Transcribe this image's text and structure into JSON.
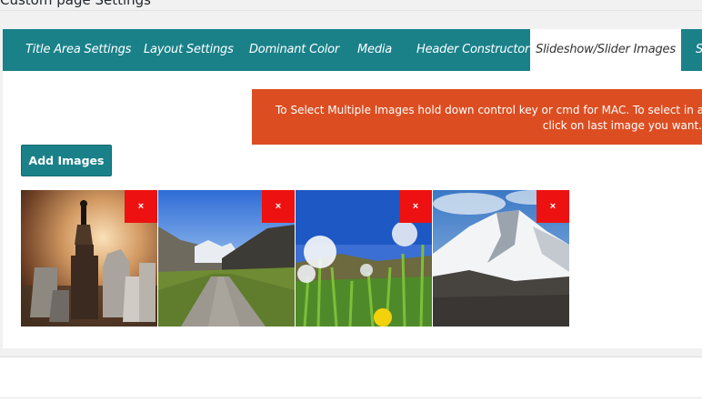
{
  "page": {
    "title": "Custom page Settings"
  },
  "tabs": [
    {
      "label": "Title Area Settings",
      "active": false
    },
    {
      "label": "Layout Settings",
      "active": false
    },
    {
      "label": "Dominant Color",
      "active": false
    },
    {
      "label": "Media",
      "active": false
    },
    {
      "label": "Header Constructor",
      "active": false
    },
    {
      "label": "Slideshow/Slider Images",
      "active": true
    },
    {
      "label": "S",
      "active": false
    }
  ],
  "notice": {
    "line1": "To Select Multiple Images hold down control key or cmd for MAC. To select in a row i",
    "line2": "click on last image you want."
  },
  "add_button": {
    "label": "Add Images"
  },
  "gallery": {
    "remove_label": "×",
    "images": [
      {
        "name": "chess-pieces-image"
      },
      {
        "name": "mountain-road-image"
      },
      {
        "name": "dandelion-meadow-image"
      },
      {
        "name": "snowy-mountain-image"
      }
    ]
  },
  "colors": {
    "tab_bar": "#1a8189",
    "notice_bg": "#dc4e22",
    "remove_button": "#ee1111",
    "button": "#1a8189"
  }
}
